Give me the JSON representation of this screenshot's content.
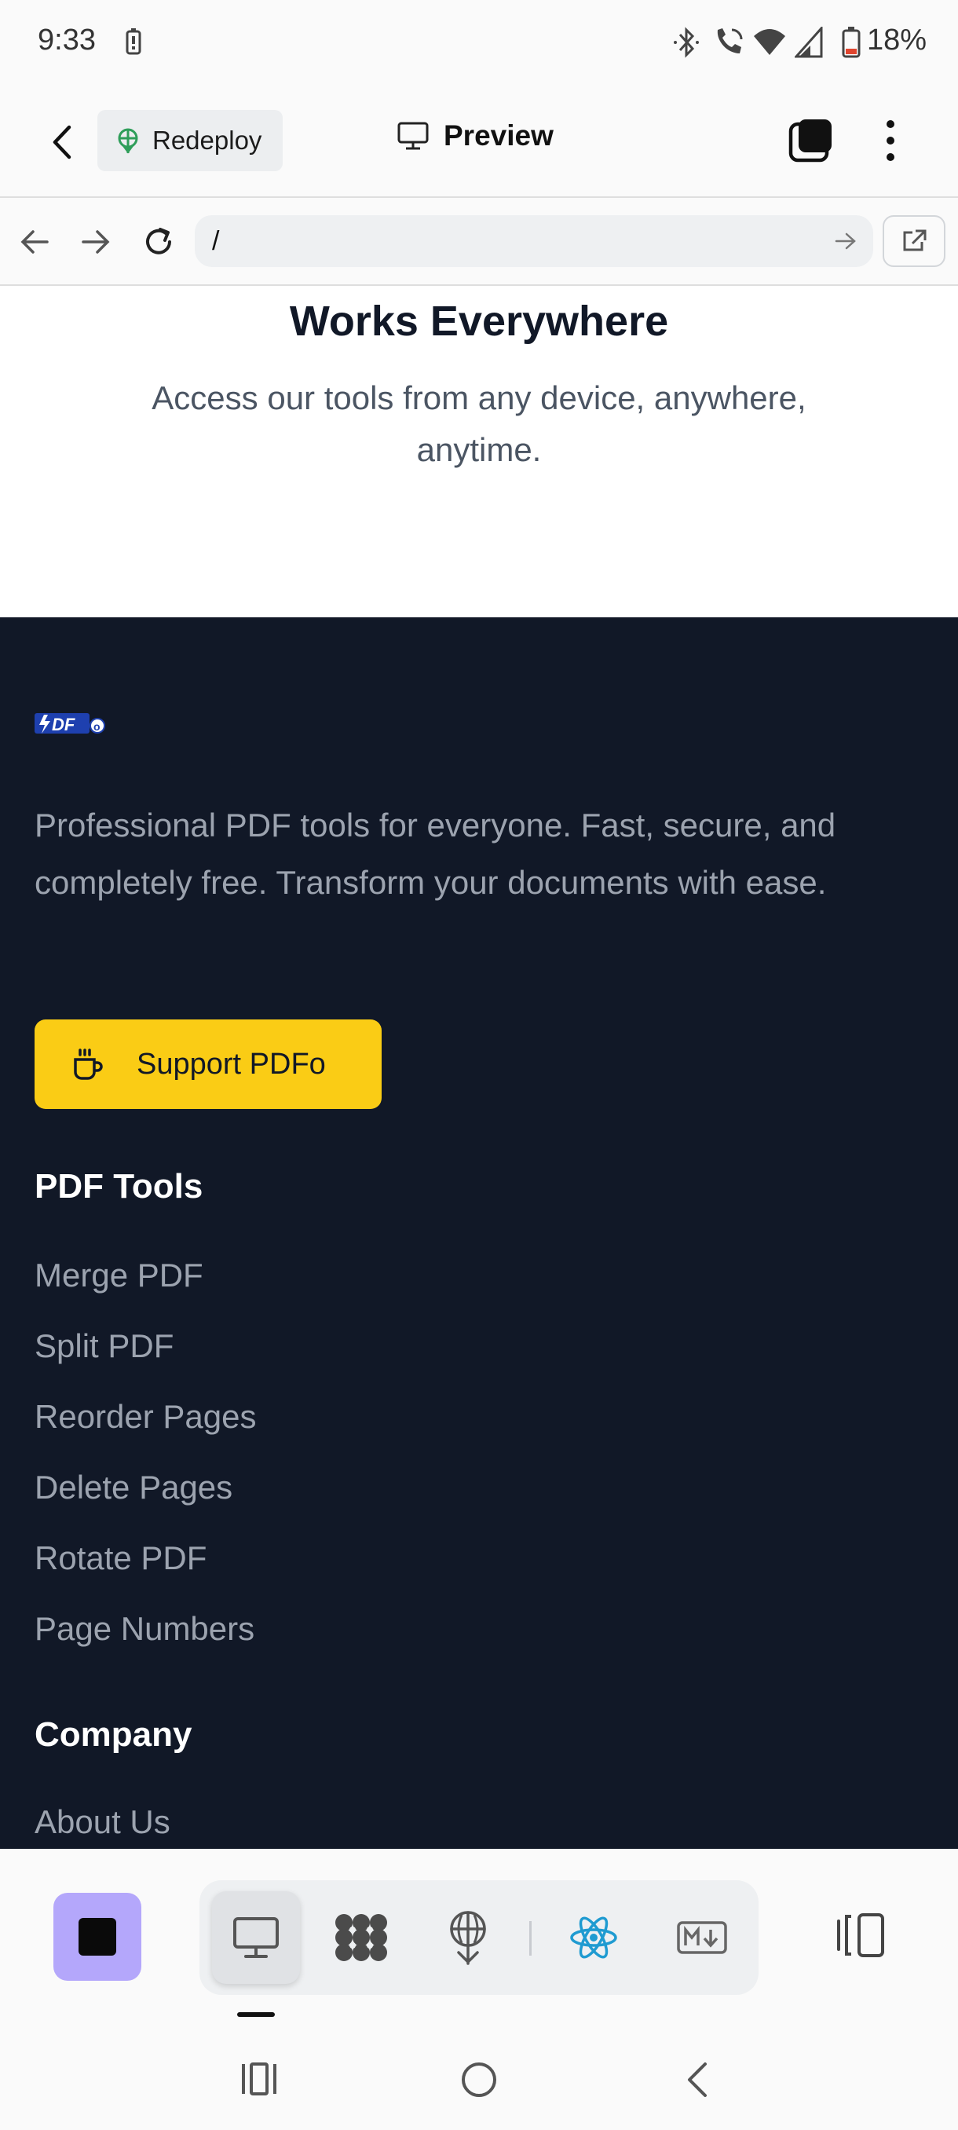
{
  "status_bar": {
    "time": "9:33",
    "battery": "18%"
  },
  "toolbar": {
    "redeploy_label": "Redeploy",
    "preview_label": "Preview"
  },
  "url_bar": {
    "url": "/"
  },
  "hero": {
    "title": "Works Everywhere",
    "subtitle": "Access our tools from any device, anywhere, anytime."
  },
  "footer": {
    "logo_text": "PDFo",
    "description": "Professional PDF tools for everyone. Fast, secure, and completely free. Transform your documents with ease.",
    "support_button": "Support PDFo",
    "pdf_tools_title": "PDF Tools",
    "pdf_tools": [
      "Merge PDF",
      "Split PDF",
      "Reorder Pages",
      "Delete Pages",
      "Rotate PDF",
      "Page Numbers"
    ],
    "company_title": "Company",
    "company_links": [
      "About Us"
    ]
  },
  "bottom_tabs": [
    "desktop-preview-icon",
    "app-grid-icon",
    "deploy-icon",
    "react-icon",
    "markdown-icon"
  ],
  "colors": {
    "footer_bg": "#111827",
    "support_button": "#facc15",
    "stop_button": "#b4a7fb",
    "react": "#1f9bd1"
  }
}
